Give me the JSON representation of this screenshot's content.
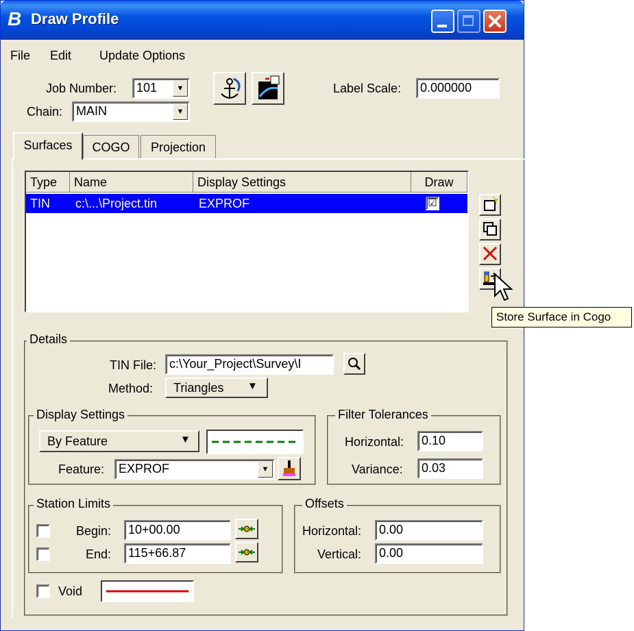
{
  "window": {
    "title": "Draw Profile",
    "app_icon": "B",
    "menu": [
      "File",
      "Edit",
      "Update Options"
    ]
  },
  "header": {
    "job_number_label": "Job Number:",
    "job_number_value": "101",
    "chain_label": "Chain:",
    "chain_value": "MAIN",
    "label_scale_label": "Label Scale:",
    "label_scale_value": "0.000000"
  },
  "tabs": [
    {
      "label": "Surfaces",
      "active": true
    },
    {
      "label": "COGO",
      "active": false
    },
    {
      "label": "Projection",
      "active": false
    }
  ],
  "surface_list": {
    "columns": [
      "Type",
      "Name",
      "Display Settings",
      "Draw"
    ],
    "rows": [
      {
        "type": "TIN",
        "name": "c:\\...\\Project.tin",
        "display_settings": "EXPROF",
        "draw": "☑"
      }
    ]
  },
  "tooltip": "Store Surface in Cogo",
  "details": {
    "title": "Details",
    "tin_file_label": "TIN File:",
    "tin_file_value": "c:\\Your_Project\\Survey\\I",
    "method_label": "Method:",
    "method_value": "Triangles"
  },
  "display_settings": {
    "title": "Display Settings",
    "mode_value": "By Feature",
    "feature_label": "Feature:",
    "feature_value": "EXPROF"
  },
  "filter_tolerances": {
    "title": "Filter Tolerances",
    "horizontal_label": "Horizontal:",
    "horizontal_value": "0.10",
    "variance_label": "Variance:",
    "variance_value": "0.03"
  },
  "station_limits": {
    "title": "Station Limits",
    "begin_label": "Begin:",
    "begin_value": "10+00.00",
    "end_label": "End:",
    "end_value": "115+66.87"
  },
  "offsets": {
    "title": "Offsets",
    "horizontal_label": "Horizontal:",
    "horizontal_value": "0.00",
    "vertical_label": "Vertical:",
    "vertical_value": "0.00"
  },
  "void": {
    "label": "Void"
  },
  "colors": {
    "selection": "#0000ff",
    "line_feature": "#008000",
    "line_void": "#e00000",
    "title_bar": "#0554e3"
  }
}
